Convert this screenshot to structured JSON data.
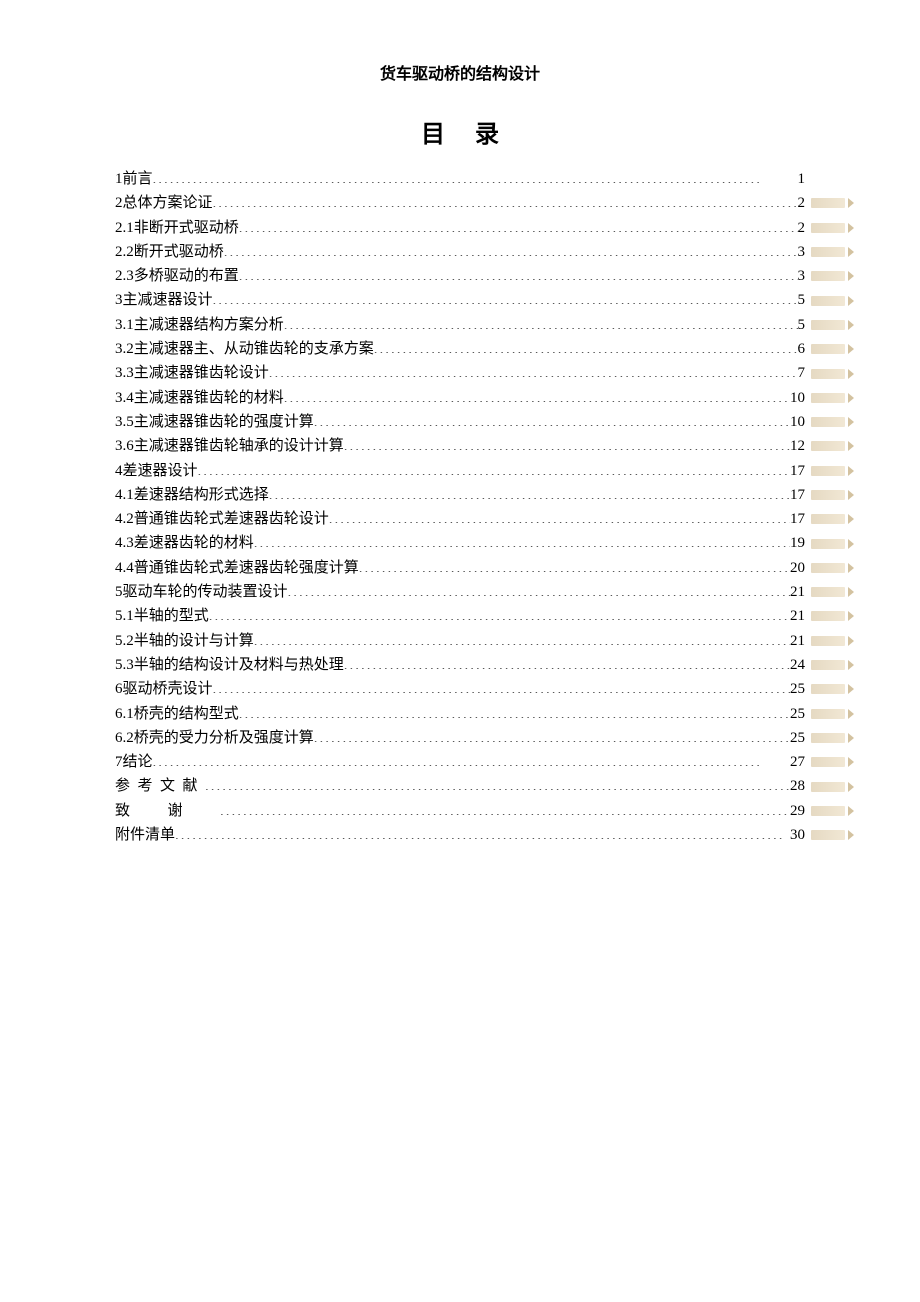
{
  "header": "货车驱动桥的结构设计",
  "toc_title": "目录",
  "entries": [
    {
      "num": "1",
      "text": "前言",
      "page": "1",
      "marker": false,
      "spaced": ""
    },
    {
      "num": "2 ",
      "text": "总体方案论证",
      "page": "2",
      "marker": true,
      "spaced": ""
    },
    {
      "num": "2.1 ",
      "text": "非断开式驱动桥",
      "page": "2",
      "marker": true,
      "spaced": ""
    },
    {
      "num": "2.2 ",
      "text": "断开式驱动桥",
      "page": "3",
      "marker": true,
      "spaced": ""
    },
    {
      "num": "2.3 ",
      "text": "多桥驱动的布置",
      "page": "3",
      "marker": true,
      "spaced": ""
    },
    {
      "num": "3 ",
      "text": "主减速器设计",
      "page": "5",
      "marker": true,
      "spaced": ""
    },
    {
      "num": "3.1 ",
      "text": "主减速器结构方案分析",
      "page": "5",
      "marker": true,
      "spaced": ""
    },
    {
      "num": "3.2 ",
      "text": "主减速器主、从动锥齿轮的支承方案",
      "page": "6",
      "marker": true,
      "spaced": ""
    },
    {
      "num": "3.3 ",
      "text": "主减速器锥齿轮设计",
      "page": "7",
      "marker": true,
      "spaced": ""
    },
    {
      "num": "3.4 ",
      "text": "主减速器锥齿轮的材料",
      "page": "10",
      "marker": true,
      "spaced": ""
    },
    {
      "num": "3.5 ",
      "text": "主减速器锥齿轮的强度计算",
      "page": "10",
      "marker": true,
      "spaced": ""
    },
    {
      "num": "3.6 ",
      "text": "主减速器锥齿轮轴承的设计计算",
      "page": "12",
      "marker": true,
      "spaced": ""
    },
    {
      "num": "4 ",
      "text": "差速器设计",
      "page": "17",
      "marker": true,
      "spaced": ""
    },
    {
      "num": "4.1 ",
      "text": "差速器结构形式选择",
      "page": "17",
      "marker": true,
      "spaced": ""
    },
    {
      "num": "4.2 ",
      "text": "普通锥齿轮式差速器齿轮设计",
      "page": "17",
      "marker": true,
      "spaced": ""
    },
    {
      "num": "4.3 ",
      "text": "差速器齿轮的材料",
      "page": "19",
      "marker": true,
      "spaced": ""
    },
    {
      "num": "4.4 ",
      "text": "普通锥齿轮式差速器齿轮强度计算",
      "page": "20",
      "marker": true,
      "spaced": ""
    },
    {
      "num": "5 ",
      "text": "驱动车轮的传动装置设计",
      "page": "21",
      "marker": true,
      "spaced": ""
    },
    {
      "num": "5.1 ",
      "text": "半轴的型式",
      "page": "21",
      "marker": true,
      "spaced": ""
    },
    {
      "num": "5.2 ",
      "text": "半轴的设计与计算",
      "page": "21",
      "marker": true,
      "spaced": ""
    },
    {
      "num": "5.3 ",
      "text": "半轴的结构设计及材料与热处理",
      "page": "24",
      "marker": true,
      "spaced": ""
    },
    {
      "num": "6 ",
      "text": "驱动桥壳设计",
      "page": "25",
      "marker": true,
      "spaced": ""
    },
    {
      "num": "6.1 ",
      "text": "桥壳的结构型式",
      "page": "25",
      "marker": true,
      "spaced": ""
    },
    {
      "num": "6.2 ",
      "text": "桥壳的受力分析及强度计算",
      "page": "25",
      "marker": true,
      "spaced": ""
    },
    {
      "num": "7 ",
      "text": "结论",
      "page": "27",
      "marker": true,
      "spaced": ""
    },
    {
      "num": "",
      "text": "参考文献",
      "page": "28",
      "marker": true,
      "spaced": "spaced"
    },
    {
      "num": "",
      "text": "致谢",
      "page": "29",
      "marker": true,
      "spaced": "spaced-wide"
    },
    {
      "num": "",
      "text": "附件清单",
      "page": "30",
      "marker": true,
      "spaced": ""
    }
  ]
}
